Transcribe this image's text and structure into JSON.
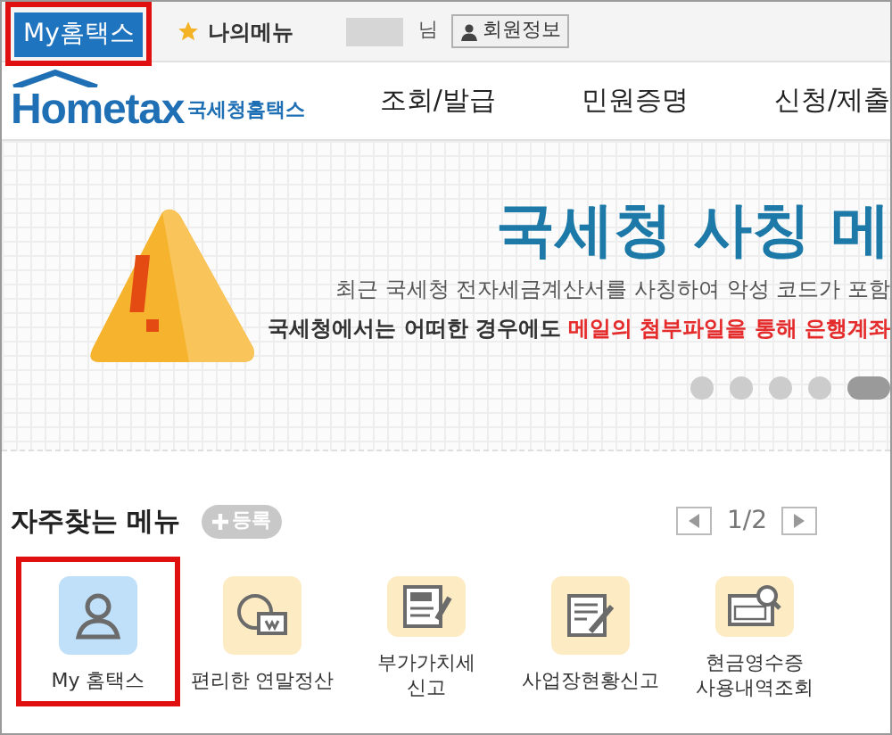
{
  "top_bar": {
    "items": [
      {
        "kind": "tab",
        "label": "My홈택스",
        "selected": true,
        "highlighted": true
      },
      {
        "kind": "star",
        "label": "나의메뉴",
        "selected": false,
        "highlighted": false
      }
    ],
    "user_suffix": "님",
    "member_button": "회원정보"
  },
  "header": {
    "logo": "Hometax",
    "logo_name": "국세청홈택스",
    "nav": [
      "조회/발급",
      "민원증명",
      "신청/제출"
    ]
  },
  "banner": {
    "title": "국세청 사칭 메",
    "line_1": "최근 국세청 전자세금계산서를 사칭하여 악성 코드가 포함",
    "line_2": "국세청에서는 어떠한 경우에도",
    "line_2_warning": "메일의 첨부파일을 통해 은행계좌",
    "dots": [
      {
        "selected": false
      },
      {
        "selected": false
      },
      {
        "selected": false
      },
      {
        "selected": false
      },
      {
        "selected": true
      }
    ]
  },
  "favorites": {
    "title": "자주찾는 메뉴",
    "add_button": "등록",
    "page": "1/2",
    "items": [
      {
        "kind": "person",
        "label": "My 홈택스",
        "selected": true,
        "highlighted": true
      },
      {
        "kind": "chat",
        "label": "편리한 연말정산",
        "selected": false,
        "highlighted": false
      },
      {
        "kind": "vat",
        "label": "부가가치세\n신고",
        "selected": false,
        "highlighted": false
      },
      {
        "kind": "form",
        "label": "사업장현황신고",
        "selected": false,
        "highlighted": false
      },
      {
        "kind": "receipt",
        "label": "현금영수증\n사용내역조회",
        "selected": false,
        "highlighted": false
      }
    ]
  }
}
